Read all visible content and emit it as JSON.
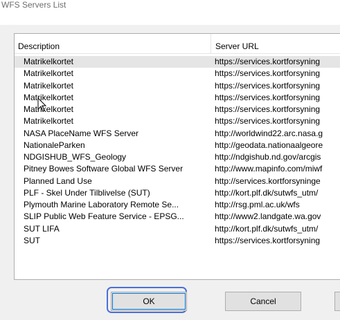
{
  "dialog": {
    "title": "WFS Servers List"
  },
  "list": {
    "columns": {
      "description": "Description",
      "server_url": "Server URL"
    },
    "rows": [
      {
        "description": "Matrikelkortet",
        "url": "https://services.kortforsyning",
        "selected": true
      },
      {
        "description": "Matrikelkortet",
        "url": "https://services.kortforsyning",
        "selected": false
      },
      {
        "description": "Matrikelkortet",
        "url": "https://services.kortforsyning",
        "selected": false
      },
      {
        "description": "Matrikelkortet",
        "url": "https://services.kortforsyning",
        "selected": false
      },
      {
        "description": "Matrikelkortet",
        "url": "https://services.kortforsyning",
        "selected": false
      },
      {
        "description": "Matrikelkortet",
        "url": "https://services.kortforsyning",
        "selected": false
      },
      {
        "description": "NASA PlaceName WFS Server",
        "url": "http://worldwind22.arc.nasa.g",
        "selected": false
      },
      {
        "description": "NationaleParken",
        "url": "http://geodata.nationaalgeore",
        "selected": false
      },
      {
        "description": "NDGISHUB_WFS_Geology",
        "url": "http://ndgishub.nd.gov/arcgis",
        "selected": false
      },
      {
        "description": "Pitney Bowes Software Global WFS Server",
        "url": "http://www.mapinfo.com/miwf",
        "selected": false
      },
      {
        "description": "Planned Land Use",
        "url": "http://services.kortforsyninge",
        "selected": false
      },
      {
        "description": "PLF - Skel Under Tilblivelse (SUT)",
        "url": "http://kort.plf.dk/sutwfs_utm/",
        "selected": false
      },
      {
        "description": "Plymouth Marine Laboratory Remote Se...",
        "url": "http://rsg.pml.ac.uk/wfs",
        "selected": false
      },
      {
        "description": "SLIP Public Web Feature Service - EPSG...",
        "url": "http://www2.landgate.wa.gov",
        "selected": false
      },
      {
        "description": "SUT LIFA",
        "url": "http://kort.plf.dk/sutwfs_utm/",
        "selected": false
      },
      {
        "description": "SUT",
        "url": "https://services.kortforsyning",
        "selected": false
      }
    ]
  },
  "buttons": {
    "ok": "OK",
    "cancel": "Cancel",
    "partial": ""
  },
  "colors": {
    "focus_ring": "#4a6fd8",
    "selected_row": "#e5e5e5"
  }
}
